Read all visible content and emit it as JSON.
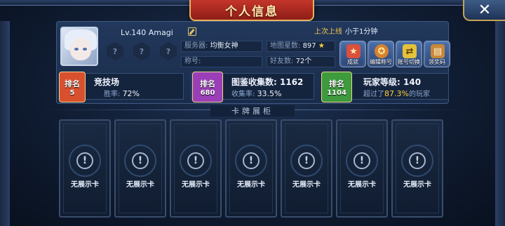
{
  "header": {
    "title": "个人信息",
    "close_icon": "close-icon"
  },
  "profile": {
    "level_name": "Lv.140 Amagi",
    "badge_placeholder": "?",
    "server_label": "服务器:",
    "server_value": "均衡女神",
    "map_stars_label": "地图星数:",
    "map_stars_value": "897",
    "star_glyph": "★",
    "nickname_label": "称号:",
    "friends_label": "好友数:",
    "friends_value": "72个",
    "last_online_label": "上次上线",
    "last_online_value": "小于1分钟"
  },
  "actions": [
    {
      "label": "成就",
      "icon": "achievement-icon",
      "color": "#d9503c"
    },
    {
      "label": "编辑称号",
      "icon": "title-medal-icon",
      "color": "#d6822c"
    },
    {
      "label": "账号切换",
      "icon": "switch-account-icon",
      "color": "#e3c23b"
    },
    {
      "label": "领奖码",
      "icon": "gift-code-icon",
      "color": "#c8873a"
    }
  ],
  "stats": [
    {
      "rank_label": "排名",
      "rank_value": "5",
      "title": "竞技场",
      "sub_label": "胜率:",
      "sub_value": "72%",
      "color": "#d8502e"
    },
    {
      "rank_label": "排名",
      "rank_value": "680",
      "title": "图鉴收集数:",
      "title_value": "1162",
      "sub_label": "收集率:",
      "sub_value": "33.5%",
      "color": "#9a3fb8"
    },
    {
      "rank_label": "排名",
      "rank_value": "1104",
      "title": "玩家等级:",
      "title_value": "140",
      "sub_label": "超过了",
      "sub_value": "87.3%",
      "sub_suffix": "的玩家",
      "color": "#3d9a3d"
    }
  ],
  "showcase": {
    "title": "卡牌展柜",
    "empty_label": "无展示卡",
    "alert_glyph": "!",
    "cards": [
      "无展示卡",
      "无展示卡",
      "无展示卡",
      "无展示卡",
      "无展示卡",
      "无展示卡",
      "无展示卡"
    ]
  }
}
